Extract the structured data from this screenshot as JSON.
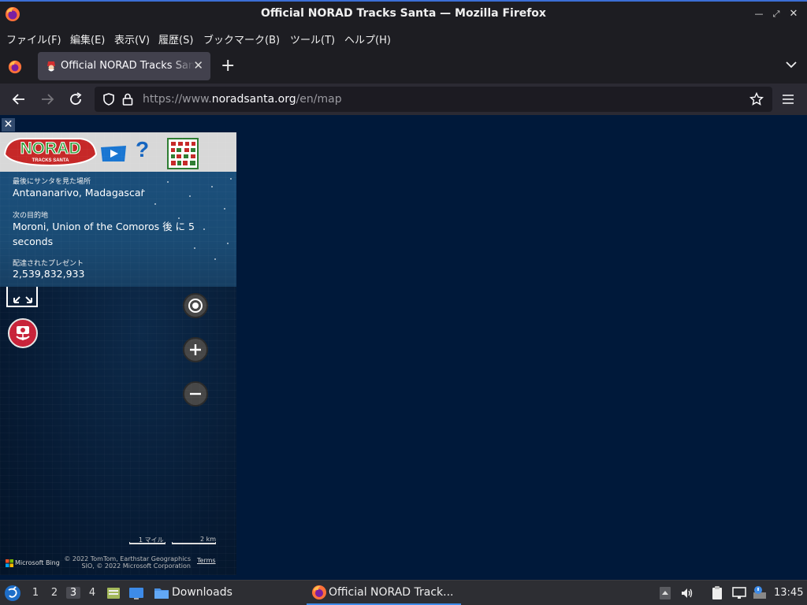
{
  "window": {
    "title": "Official NORAD Tracks Santa — Mozilla Firefox"
  },
  "menu": {
    "items": [
      "ファイル(F)",
      "編集(E)",
      "表示(V)",
      "履歴(S)",
      "ブックマーク(B)",
      "ツール(T)",
      "ヘルプ(H)"
    ]
  },
  "tabs": {
    "active_title": "Official NORAD Tracks Santa",
    "new_tab": "+"
  },
  "nav": {
    "url_prefix": "https://www.",
    "url_host": "noradsanta.org",
    "url_path": "/en/map"
  },
  "panel": {
    "close": "✕",
    "last_seen_label": "最後にサンタを見た場所",
    "last_seen_value": "Antananarivo, Madagascar",
    "next_stop_label": "次の目的地",
    "next_stop_value": "Moroni, Union of the Comoros 後 に 5 seconds",
    "gifts_label": "配達されたプレゼント",
    "gifts_value": "2,539,832,933",
    "logo_text": "NORAD",
    "logo_sub": "TRACKS SANTA",
    "help": "?"
  },
  "map": {
    "scale_miles": "1 マイル",
    "scale_km": "2 km",
    "bing": "Microsoft Bing",
    "attribution_line1": "© 2022 TomTom, Earthstar Geographics",
    "attribution_line2": "SIO, © 2022 Microsoft Corporation",
    "terms": "Terms"
  },
  "taskbar": {
    "workspaces": [
      "1",
      "2",
      "3",
      "4"
    ],
    "active_workspace": "3",
    "downloads": "Downloads",
    "task_title": "Official NORAD Track...",
    "clock": "13:45"
  },
  "colors": {
    "accent": "#3b6fd6",
    "page_bg": "#00193a",
    "info_bg": "#1b4f7b",
    "cam_red": "#c8233a"
  }
}
